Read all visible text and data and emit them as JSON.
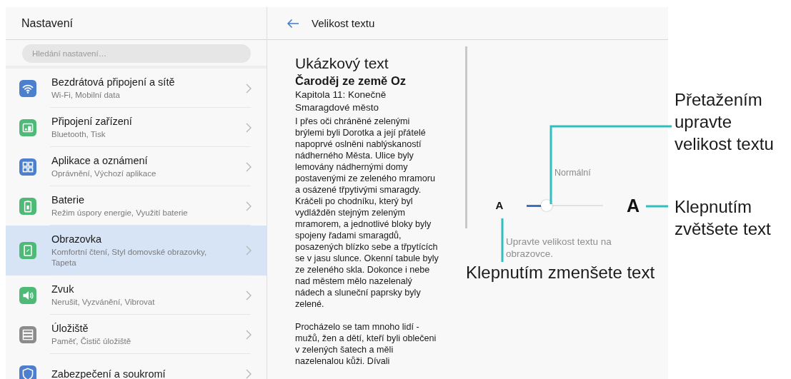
{
  "settings": {
    "title": "Nastavení",
    "search": {
      "placeholder": "Hledání nastavení…"
    },
    "items": [
      {
        "title": "Bezdrátová připojení a sítě",
        "subtitle": "Wi-Fi, Mobilní data",
        "color": "#4c80cf",
        "selected": false
      },
      {
        "title": "Připojení zařízení",
        "subtitle": "Bluetooth, Tisk",
        "color": "#4fba78",
        "selected": false
      },
      {
        "title": "Aplikace a oznámení",
        "subtitle": "Oprávnění, Výchozí aplikace",
        "color": "#4c80cf",
        "selected": false
      },
      {
        "title": "Baterie",
        "subtitle": "Režim úspory energie, Využití baterie",
        "color": "#4fba78",
        "selected": false
      },
      {
        "title": "Obrazovka",
        "subtitle": "Komfortní čtení, Styl domovské obrazovky, Tapeta",
        "color": "#4fba78",
        "selected": true
      },
      {
        "title": "Zvuk",
        "subtitle": "Nerušit, Vyzvánění, Vibrovat",
        "color": "#4fba78",
        "selected": false
      },
      {
        "title": "Úložiště",
        "subtitle": "Paměť, Čistič úložiště",
        "color": "#8c8c8c",
        "selected": false
      },
      {
        "title": "Zabezpečení a soukromí",
        "color": "#4c80cf",
        "selected": false
      }
    ]
  },
  "text_size": {
    "title": "Velikost textu",
    "preview": {
      "heading": "Ukázkový text",
      "book_title": "Čaroděj ze země Oz",
      "chapter": "Kapitola 11: Konečně Smaragdové město",
      "paragraphs": [
        "I přes oči chráněné zelenými brýlemi byli Dorotka a její přátelé napoprvé oslněni nablýskaností nádherného Města. Ulice byly lemovány nádhernými domy postavenými ze zeleného mramoru a osázené třpytivými smaragdy. Kráčeli po chodníku, který byl vydlážděn stejným zeleným mramorem, a jednotlivé bloky byly spojeny řadami smaragdů, posazených blízko sebe a třpytících se v jasu slunce. Okenní tabule byly ze zeleného skla. Dokonce i nebe nad městem mělo nazelenalý nádech a sluneční paprsky byly zelené.",
        "Procházelo se tam mnoho lidí - mužů, žen a dětí, kteří byli oblečeni v zelených šatech a měli nazelenalou kůži. Dívali"
      ]
    },
    "size_label": "Normální",
    "slider": {
      "small_label": "A",
      "large_label": "A",
      "level": 0.26
    },
    "description": "Upravte velikost textu na obrazovce."
  },
  "callouts": [
    {
      "kind": "drag",
      "text": "Přetažením upravte velikost textu"
    },
    {
      "kind": "increase",
      "text": "Klepnutím zvětšete text"
    },
    {
      "kind": "decrease",
      "text": "Klepnutím zmenšete text"
    }
  ]
}
